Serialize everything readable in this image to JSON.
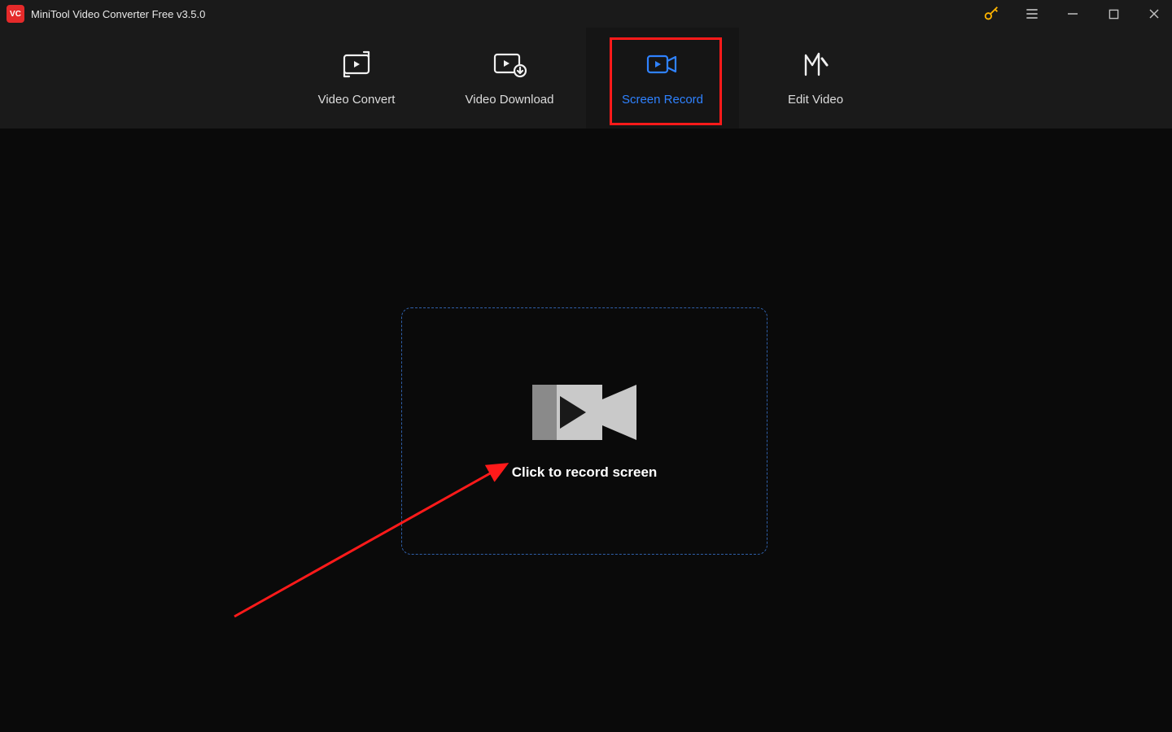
{
  "app": {
    "logo_text": "VC",
    "title": "MiniTool Video Converter Free v3.5.0"
  },
  "tabs": {
    "convert": "Video Convert",
    "download": "Video Download",
    "record": "Screen Record",
    "edit": "Edit Video"
  },
  "content": {
    "record_prompt": "Click to record screen"
  },
  "colors": {
    "accent": "#2f82ff",
    "highlight": "#ff1a1a",
    "key_icon": "#ffb400"
  }
}
